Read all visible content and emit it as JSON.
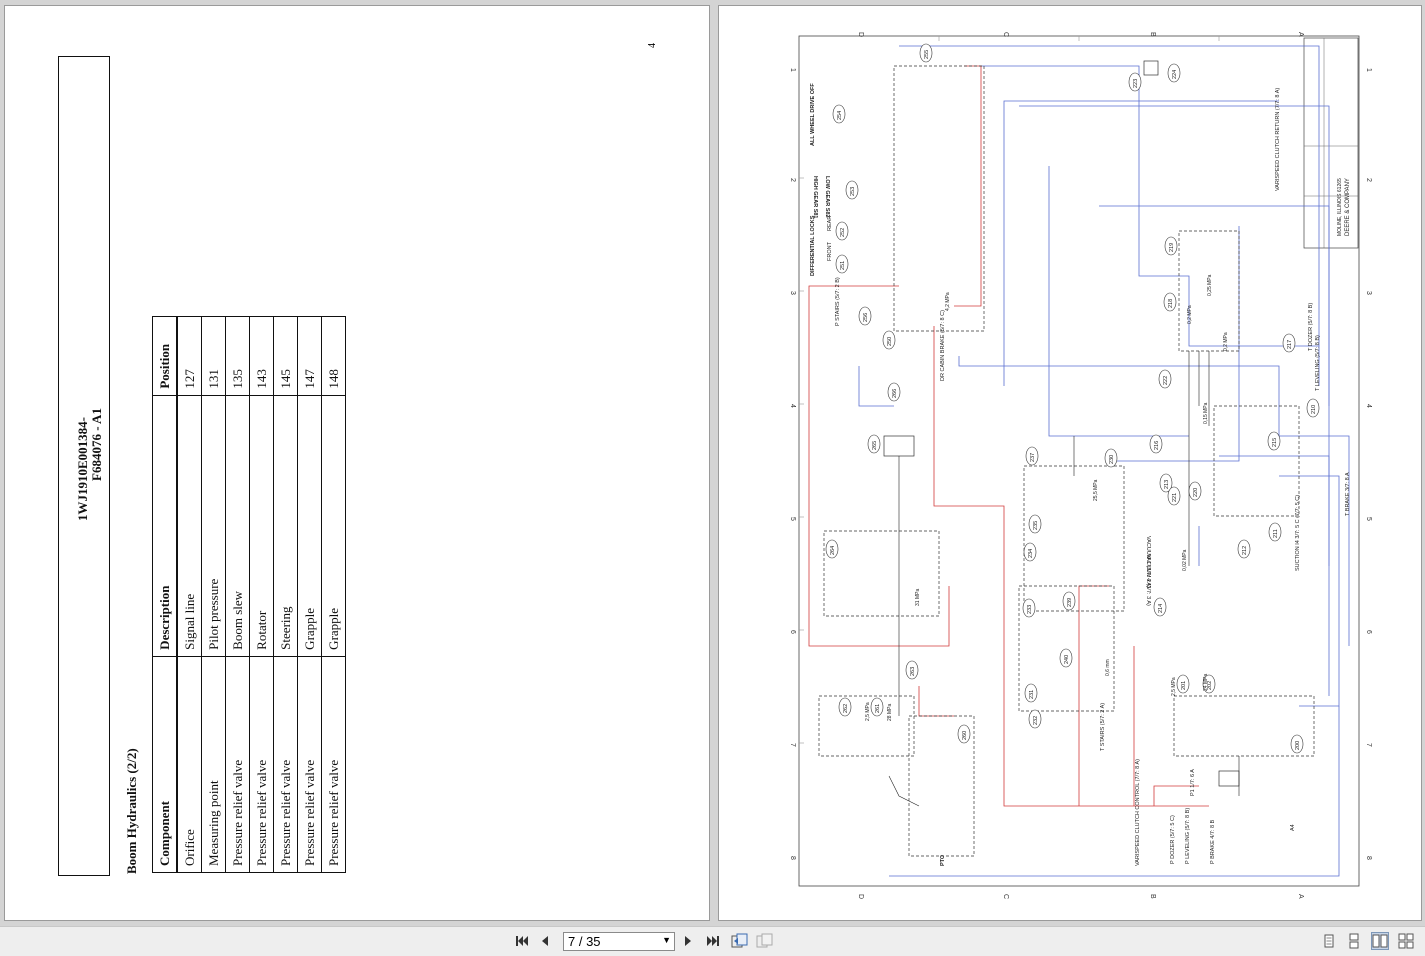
{
  "viewer": {
    "page_input": "7 / 35",
    "view_modes": [
      "single-page",
      "continuous",
      "two-page",
      "two-page-continuous"
    ],
    "active_view_mode": "two-page"
  },
  "left_page": {
    "doc_id_line1": "1WJ1910E001384-",
    "doc_id_line2": "F684076 - A1",
    "section_title": "Boom Hydraulics (2/2)",
    "page_number": "4",
    "table": {
      "headers": [
        "Component",
        "Description",
        "Position"
      ],
      "rows": [
        [
          "Orifice",
          "Signal line",
          "127"
        ],
        [
          "Measuring point",
          "Pilot pressure",
          "131"
        ],
        [
          "Pressure relief valve",
          "Boom slew",
          "135"
        ],
        [
          "Pressure relief valve",
          "Rotator",
          "143"
        ],
        [
          "Pressure relief valve",
          "Steering",
          "145"
        ],
        [
          "Pressure relief valve",
          "Grapple",
          "147"
        ],
        [
          "Pressure relief valve",
          "Grapple",
          "148"
        ]
      ]
    }
  },
  "right_page": {
    "title_block": [
      "DEERE & COMPANY",
      "MOLINE, ILLINOIS 61265"
    ],
    "zone_letters": [
      "D",
      "C",
      "B",
      "A"
    ],
    "zone_numbers": [
      "1",
      "2",
      "3",
      "4",
      "5",
      "6",
      "7",
      "8"
    ],
    "labels": {
      "diff_locks": "DIFFERENTIAL LOCKS",
      "front": "FRONT",
      "rear": "REAR",
      "all_wheel": "ALL WHEEL DRIVE OFF",
      "high_gear": "HIGH GEAR S81",
      "low_gear": "LOW GEAR S82",
      "p_stairs": "P STAIRS (5/7: 2 B)",
      "dr_cabin_brake": "DR CABIN BRAKE (5/7: 8 C)",
      "varispeed_return": "VARISPEED CLUTCH RETURN (7/7: 8 A)",
      "t_brake": "T BRAKE 3/7: 8 A",
      "suction": "SUCTION I4 3/7: 5 C (7/7: 5 C)",
      "vacuum1": "VACUUM 1 (3/7: 4 A)",
      "vacuum2": "VACUUM 2 (3/7: 3 A)",
      "t_stairs": "T STAIRS (5/7: 2 A)",
      "t_leveling": "T LEVELING (5/7: 8 B)",
      "t_dozer": "T DOZER (5/7: 8 B)",
      "p_dozer": "P DOZER (5/7: 5 C)",
      "p_leveling": "P LEVELING (5/7: 8 B)",
      "p_brake": "P BRAKE 4/7: 8 B",
      "varispeed_control": "VARISPEED CLUTCH CONTROL (7/7: 8 A)",
      "pto": "PTO",
      "p1": "P1 1/7: 6 A",
      "a4": "A4"
    },
    "callouts": [
      "255",
      "254",
      "253",
      "252",
      "251",
      "256",
      "250",
      "223",
      "224",
      "219",
      "218",
      "222",
      "216",
      "217",
      "210",
      "215",
      "213",
      "220",
      "221",
      "211",
      "212",
      "214",
      "237",
      "230",
      "235",
      "234",
      "233",
      "239",
      "240",
      "231",
      "232",
      "265",
      "266",
      "264",
      "263",
      "262",
      "261",
      "260",
      "201",
      "202",
      "200"
    ],
    "pressures": [
      "4,2 MPa",
      "31 MPa",
      "25,5 MPa",
      "0,6 mm",
      "2,5 MPa",
      "28 MPa",
      "0,2 MPa",
      "0,25 MPa",
      "0,15 MPa",
      "0,2 MPa",
      "0,02 MPa",
      "24 MPa",
      "2,5 MPa"
    ]
  }
}
